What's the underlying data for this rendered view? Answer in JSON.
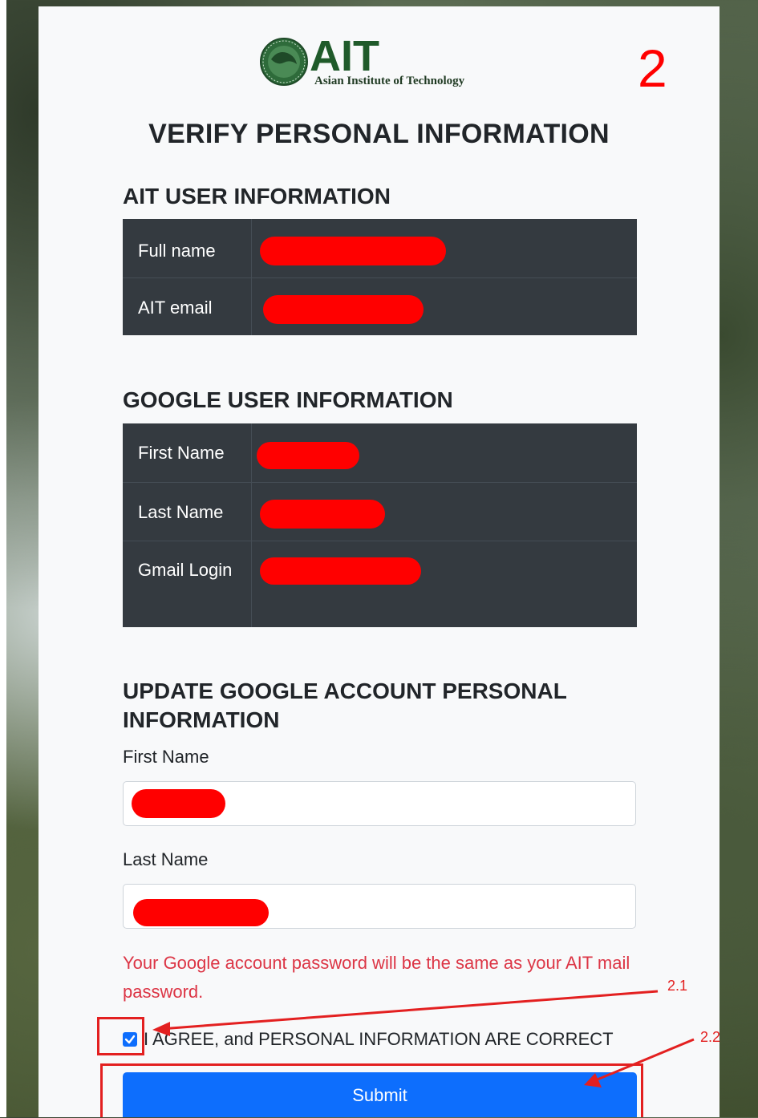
{
  "logo": {
    "text": "AIT",
    "subtitle": "Asian Institute of Technology"
  },
  "step_number": "2",
  "page_title": "VERIFY PERSONAL INFORMATION",
  "ait_section": {
    "title": "AIT USER INFORMATION",
    "rows": [
      {
        "label": "Full name"
      },
      {
        "label": "AIT email"
      }
    ]
  },
  "google_section": {
    "title": "GOOGLE USER INFORMATION",
    "rows": [
      {
        "label": "First Name"
      },
      {
        "label": "Last Name"
      },
      {
        "label": "Gmail Login"
      }
    ]
  },
  "update_section": {
    "title": "UPDATE GOOGLE ACCOUNT PERSONAL INFORMATION",
    "first_name_label": "First Name",
    "last_name_label": "Last Name"
  },
  "note": "Your Google account password will be the same as your AIT mail password.",
  "agree": {
    "label": "I AGREE, and PERSONAL INFORMATION ARE CORRECT",
    "checked": true
  },
  "submit_label": "Submit",
  "annotations": {
    "a1": "2.1",
    "a2": "2.2"
  },
  "colors": {
    "accent": "#0d6efd",
    "redaction": "#ff0000",
    "warning_text": "#dc3545",
    "annotation": "#e32020"
  }
}
